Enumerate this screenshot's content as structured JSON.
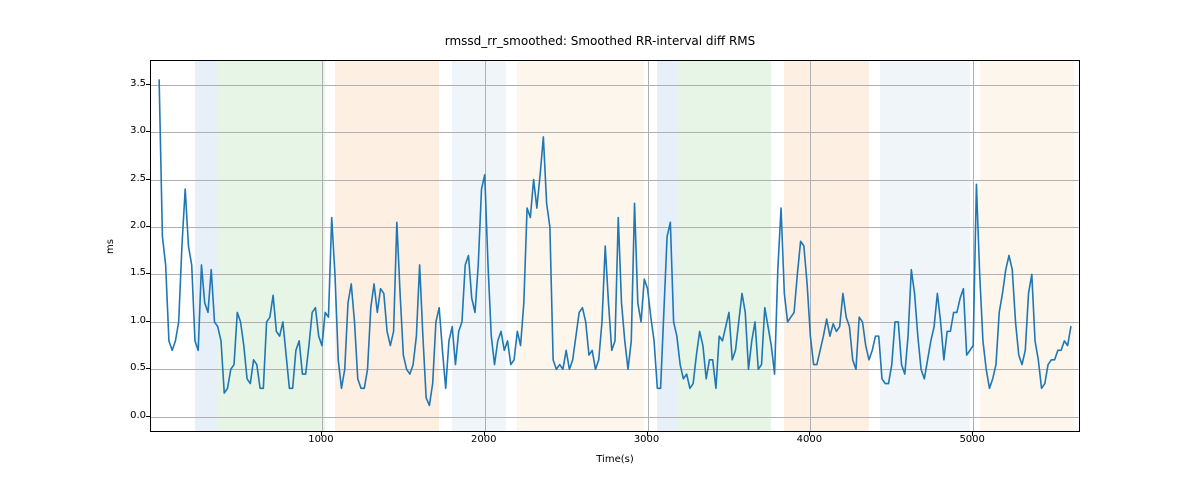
{
  "chart_data": {
    "type": "line",
    "title": "rmssd_rr_smoothed: Smoothed RR-interval diff RMS",
    "xlabel": "Time(s)",
    "ylabel": "ms",
    "xlim": [
      -50,
      5650
    ],
    "ylim": [
      -0.15,
      3.75
    ],
    "xticks": [
      1000,
      2000,
      3000,
      4000,
      5000
    ],
    "yticks": [
      0.0,
      0.5,
      1.0,
      1.5,
      2.0,
      2.5,
      3.0,
      3.5
    ],
    "bands": [
      {
        "x0": 220,
        "x1": 360,
        "color": "blue"
      },
      {
        "x0": 360,
        "x1": 1020,
        "color": "green"
      },
      {
        "x0": 1020,
        "x1": 1080,
        "color": "white"
      },
      {
        "x0": 1080,
        "x1": 1720,
        "color": "orange"
      },
      {
        "x0": 1720,
        "x1": 1800,
        "color": "white"
      },
      {
        "x0": 1800,
        "x1": 2130,
        "color": "lblue"
      },
      {
        "x0": 2130,
        "x1": 2200,
        "color": "white"
      },
      {
        "x0": 2200,
        "x1": 2980,
        "color": "lorange"
      },
      {
        "x0": 2980,
        "x1": 3060,
        "color": "white"
      },
      {
        "x0": 3060,
        "x1": 3190,
        "color": "blue"
      },
      {
        "x0": 3190,
        "x1": 3760,
        "color": "green"
      },
      {
        "x0": 3760,
        "x1": 3840,
        "color": "white"
      },
      {
        "x0": 3840,
        "x1": 4360,
        "color": "orange"
      },
      {
        "x0": 4360,
        "x1": 4430,
        "color": "white"
      },
      {
        "x0": 4430,
        "x1": 4980,
        "color": "lblue"
      },
      {
        "x0": 4980,
        "x1": 5040,
        "color": "white"
      },
      {
        "x0": 5040,
        "x1": 5620,
        "color": "lorange"
      }
    ],
    "series": [
      {
        "name": "rmssd_rr_smoothed",
        "color": "#1f77b4",
        "x": [
          0,
          20,
          40,
          60,
          80,
          100,
          120,
          140,
          160,
          180,
          200,
          220,
          240,
          260,
          280,
          300,
          320,
          340,
          360,
          380,
          400,
          420,
          440,
          460,
          480,
          500,
          520,
          540,
          560,
          580,
          600,
          620,
          640,
          660,
          680,
          700,
          720,
          740,
          760,
          780,
          800,
          820,
          840,
          860,
          880,
          900,
          920,
          940,
          960,
          980,
          1000,
          1020,
          1040,
          1060,
          1080,
          1100,
          1120,
          1140,
          1160,
          1180,
          1200,
          1220,
          1240,
          1260,
          1280,
          1300,
          1320,
          1340,
          1360,
          1380,
          1400,
          1420,
          1440,
          1460,
          1480,
          1500,
          1520,
          1540,
          1560,
          1580,
          1600,
          1620,
          1640,
          1660,
          1680,
          1700,
          1720,
          1740,
          1760,
          1780,
          1800,
          1820,
          1840,
          1860,
          1880,
          1900,
          1920,
          1940,
          1960,
          1980,
          2000,
          2020,
          2040,
          2060,
          2080,
          2100,
          2120,
          2140,
          2160,
          2180,
          2200,
          2220,
          2240,
          2260,
          2280,
          2300,
          2320,
          2340,
          2360,
          2380,
          2400,
          2420,
          2440,
          2460,
          2480,
          2500,
          2520,
          2540,
          2560,
          2580,
          2600,
          2620,
          2640,
          2660,
          2680,
          2700,
          2720,
          2740,
          2760,
          2780,
          2800,
          2820,
          2840,
          2860,
          2880,
          2900,
          2920,
          2940,
          2960,
          2980,
          3000,
          3020,
          3040,
          3060,
          3080,
          3100,
          3120,
          3140,
          3160,
          3180,
          3200,
          3220,
          3240,
          3260,
          3280,
          3300,
          3320,
          3340,
          3360,
          3380,
          3400,
          3420,
          3440,
          3460,
          3480,
          3500,
          3520,
          3540,
          3560,
          3580,
          3600,
          3620,
          3640,
          3660,
          3680,
          3700,
          3720,
          3740,
          3760,
          3780,
          3800,
          3820,
          3840,
          3860,
          3880,
          3900,
          3920,
          3940,
          3960,
          3980,
          4000,
          4020,
          4040,
          4060,
          4080,
          4100,
          4120,
          4140,
          4160,
          4180,
          4200,
          4220,
          4240,
          4260,
          4280,
          4300,
          4320,
          4340,
          4360,
          4380,
          4400,
          4420,
          4440,
          4460,
          4480,
          4500,
          4520,
          4540,
          4560,
          4580,
          4600,
          4620,
          4640,
          4660,
          4680,
          4700,
          4720,
          4740,
          4760,
          4780,
          4800,
          4820,
          4840,
          4860,
          4880,
          4900,
          4920,
          4940,
          4960,
          4980,
          5000,
          5020,
          5040,
          5060,
          5080,
          5100,
          5120,
          5140,
          5160,
          5180,
          5200,
          5220,
          5240,
          5260,
          5280,
          5300,
          5320,
          5340,
          5360,
          5380,
          5400,
          5420,
          5440,
          5460,
          5480,
          5500,
          5520,
          5540,
          5560,
          5580,
          5600
        ],
        "y": [
          3.55,
          1.9,
          1.6,
          0.8,
          0.7,
          0.8,
          1.0,
          1.8,
          2.4,
          1.8,
          1.6,
          0.8,
          0.7,
          1.6,
          1.2,
          1.1,
          1.55,
          1.0,
          0.95,
          0.8,
          0.25,
          0.3,
          0.5,
          0.55,
          1.1,
          1.0,
          0.75,
          0.4,
          0.35,
          0.6,
          0.55,
          0.3,
          0.3,
          1.0,
          1.05,
          1.28,
          0.9,
          0.85,
          1.0,
          0.65,
          0.3,
          0.3,
          0.7,
          0.8,
          0.45,
          0.45,
          0.75,
          1.1,
          1.15,
          0.85,
          0.75,
          1.1,
          1.05,
          2.1,
          1.5,
          0.6,
          0.3,
          0.5,
          1.2,
          1.4,
          1.0,
          0.4,
          0.3,
          0.3,
          0.5,
          1.15,
          1.4,
          1.1,
          1.35,
          1.3,
          0.9,
          0.75,
          0.9,
          2.05,
          1.3,
          0.65,
          0.5,
          0.45,
          0.55,
          0.85,
          1.6,
          0.85,
          0.2,
          0.12,
          0.35,
          1.0,
          1.15,
          0.7,
          0.3,
          0.8,
          0.95,
          0.55,
          0.9,
          1.0,
          1.6,
          1.7,
          1.25,
          1.1,
          1.6,
          2.4,
          2.55,
          1.6,
          0.85,
          0.55,
          0.8,
          0.9,
          0.7,
          0.8,
          0.55,
          0.6,
          0.9,
          0.75,
          1.2,
          2.2,
          2.1,
          2.5,
          2.2,
          2.55,
          2.95,
          2.25,
          2.0,
          0.6,
          0.5,
          0.55,
          0.5,
          0.7,
          0.5,
          0.6,
          0.85,
          1.1,
          1.15,
          1.0,
          0.65,
          0.7,
          0.5,
          0.6,
          1.0,
          1.8,
          1.2,
          0.7,
          0.8,
          2.1,
          1.2,
          0.8,
          0.5,
          0.8,
          2.25,
          1.2,
          1.0,
          1.45,
          1.35,
          1.05,
          0.8,
          0.3,
          0.3,
          1.1,
          1.9,
          2.05,
          1.0,
          0.85,
          0.55,
          0.4,
          0.45,
          0.3,
          0.35,
          0.65,
          0.9,
          0.75,
          0.4,
          0.6,
          0.6,
          0.3,
          0.85,
          0.8,
          0.95,
          1.1,
          0.6,
          0.7,
          1.0,
          1.3,
          1.1,
          0.5,
          0.8,
          1.0,
          0.5,
          0.55,
          1.15,
          0.95,
          0.75,
          0.45,
          1.55,
          2.2,
          1.3,
          1.0,
          1.05,
          1.1,
          1.5,
          1.85,
          1.8,
          1.4,
          0.85,
          0.55,
          0.55,
          0.7,
          0.85,
          1.03,
          0.85,
          0.98,
          0.9,
          0.95,
          1.3,
          1.05,
          0.95,
          0.6,
          0.5,
          1.05,
          1.0,
          0.75,
          0.6,
          0.7,
          0.85,
          0.85,
          0.4,
          0.35,
          0.35,
          0.55,
          1.0,
          1.0,
          0.55,
          0.45,
          0.85,
          1.55,
          1.3,
          0.85,
          0.5,
          0.4,
          0.6,
          0.8,
          0.95,
          1.3,
          1.0,
          0.6,
          0.9,
          0.9,
          1.1,
          1.1,
          1.25,
          1.35,
          0.65,
          0.7,
          0.75,
          2.45,
          1.5,
          0.8,
          0.5,
          0.3,
          0.4,
          0.55,
          1.1,
          1.3,
          1.55,
          1.7,
          1.55,
          1.0,
          0.65,
          0.55,
          0.7,
          1.3,
          1.5,
          0.8,
          0.6,
          0.3,
          0.35,
          0.55,
          0.6,
          0.6,
          0.7,
          0.7,
          0.8,
          0.75,
          0.95
        ]
      }
    ]
  }
}
